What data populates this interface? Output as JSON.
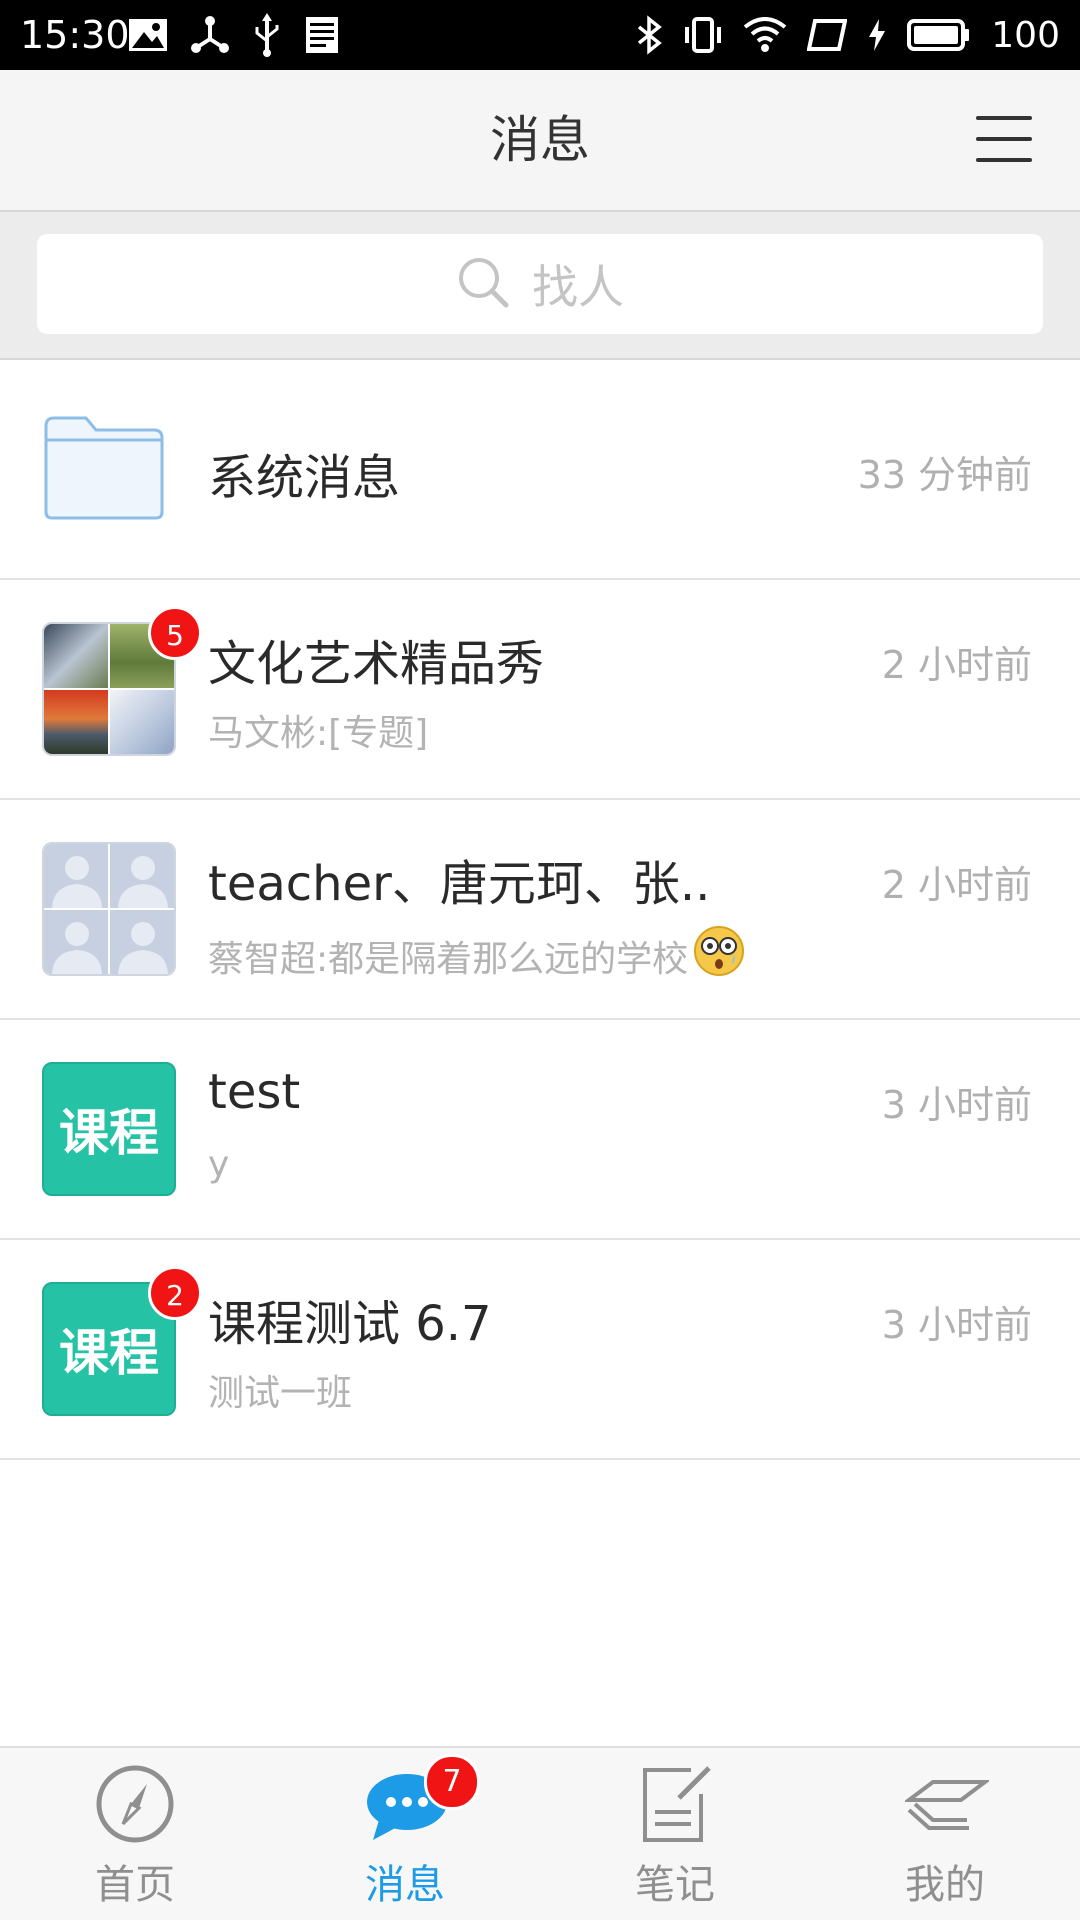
{
  "status_bar": {
    "time": "15:30",
    "battery": "100",
    "left_icons": [
      "image-icon",
      "share-hub-icon",
      "usb-icon",
      "document-icon"
    ],
    "right_icons": [
      "bluetooth-icon",
      "vibrate-icon",
      "wifi-icon",
      "screen-rotate-icon",
      "charging-icon",
      "battery-icon"
    ]
  },
  "header": {
    "title": "消息",
    "menu_icon": "hamburger-menu-icon"
  },
  "search": {
    "placeholder": "找人",
    "icon": "search-icon"
  },
  "conversations": [
    {
      "title": "系统消息",
      "subtitle": "",
      "time": "33 分钟前",
      "avatar": "folder-icon",
      "badge": ""
    },
    {
      "title": "文化艺术精品秀",
      "subtitle": "马文彬:[专题]",
      "time": "2 小时前",
      "avatar": "photo-collage",
      "badge": "5"
    },
    {
      "title": "teacher、唐元珂、张..",
      "subtitle": "蔡智超:都是隔着那么远的学校",
      "time": "2 小时前",
      "avatar": "group-avatar",
      "badge": ""
    },
    {
      "title": "test",
      "subtitle": "y",
      "time": "3 小时前",
      "avatar_label": "课程",
      "badge": ""
    },
    {
      "title": "课程测试 6.7",
      "subtitle": "测试一班",
      "time": "3 小时前",
      "avatar_label": "课程",
      "badge": "2"
    }
  ],
  "tabbar": {
    "tabs": [
      {
        "label": "首页",
        "icon": "compass-icon",
        "active": false
      },
      {
        "label": "消息",
        "icon": "chat-bubble-icon",
        "active": true,
        "badge": "7"
      },
      {
        "label": "笔记",
        "icon": "note-edit-icon",
        "active": false
      },
      {
        "label": "我的",
        "icon": "stack-icon",
        "active": false
      }
    ]
  },
  "colors": {
    "accent": "#1e9be6",
    "badge": "#f01414",
    "course": "#26c2a5"
  }
}
